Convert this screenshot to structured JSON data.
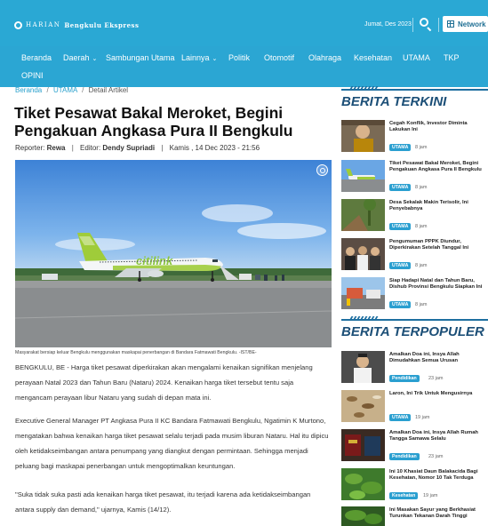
{
  "header": {
    "logo_harian": "HARIAN",
    "logo_name": "Bengkulu Ekspress",
    "date": "Jumat, Des 2023",
    "network_label": "Network"
  },
  "nav": {
    "items": [
      {
        "label": "Beranda"
      },
      {
        "label": "Daerah",
        "caret": "⌄"
      },
      {
        "label": "Sambungan Utama"
      },
      {
        "label": "Lainnya",
        "caret": "⌄"
      },
      {
        "label": "Politik"
      },
      {
        "label": "Otomotif"
      },
      {
        "label": "Olahraga"
      },
      {
        "label": "Kesehatan"
      },
      {
        "label": "UTAMA"
      },
      {
        "label": "TKP"
      },
      {
        "label": "OPINI"
      }
    ]
  },
  "breadcrumb": {
    "home": "Beranda",
    "section": "UTAMA",
    "current": "Detail Artikel",
    "separator": "/"
  },
  "article": {
    "title": "Tiket Pesawat Bakal Meroket, Begini Pengakuan Angkasa Pura II Bengkulu",
    "reporter_label": "Reporter:",
    "reporter": "Rewa",
    "editor_label": "Editor:",
    "editor": "Dendy Supriadi",
    "datetime": "Kamis , 14 Dec 2023 - 21:56",
    "meta_separator": "|",
    "aircraft_livery": "citilink",
    "caption": "Masyarakat bersiap keluar Bengkulu menggunakan maskapai penerbangan di Bandara Fatmawati Bengkulu. -IST/BE-",
    "paragraphs": [
      "BENGKULU, BE - Harga tiket pesawat diperkirakan akan mengalami kenaikan signifikan menjelang perayaan Natal 2023 dan Tahun Baru (Nataru) 2024. Kenaikan harga tiket tersebut tentu saja mengancam perayaan libur Nataru yang sudah di depan mata ini.",
      "Executive General Manager PT Angkasa Pura II KC Bandara Fatmawati Bengkulu, Ngatimin K Murtono, mengatakan bahwa kenaikan harga tiket pesawat selalu terjadi pada musim liburan Nataru. Hal itu dipicu oleh ketidakseimbangan antara penumpang yang diangkut dengan permintaan. Sehingga menjadi peluang bagi maskapai penerbangan untuk mengoptimalkan keuntungan.",
      "\"Suka tidak suka pasti ada kenaikan harga tiket pesawat, itu terjadi karena ada ketidakseimbangan antara supply dan demand,\" ujarnya, Kamis (14/12)."
    ]
  },
  "sidebar": {
    "terkini_title": "BERITA TERKINI",
    "terkini": [
      {
        "title": "Cegah Konflik, Investor Diminta Lakukan Ini",
        "badge": "UTAMA",
        "time": "8 jam"
      },
      {
        "title": "Tiket Pesawat Bakal Meroket, Begini Pengakuan Angkasa Pura II Bengkulu",
        "badge": "UTAMA",
        "time": "8 jam"
      },
      {
        "title": "Desa Sekalak Makin Terisolir, Ini Penyebabnya",
        "badge": "UTAMA",
        "time": "8 jam"
      },
      {
        "title": "Pengumuman PPPK Diundur, Diperkirakan Setelah Tanggal Ini",
        "badge": "UTAMA",
        "time": "8 jam"
      },
      {
        "title": "Siap Hadapi Natal dan Tahun Baru, Dishub Provinsi Bengkulu Siapkan Ini",
        "badge": "UTAMA",
        "time": "8 jam"
      }
    ],
    "populer_title": "BERITA TERPOPULER",
    "populer": [
      {
        "title": "Amalkan Doa ini, Insya Allah Dimudahkan Semua Urusan",
        "badge": "Pendidikan",
        "time": "23 jam"
      },
      {
        "title": "Laron, Ini Trik Untuk Mengusirnya",
        "badge": "UTAMA",
        "time": "19 jam"
      },
      {
        "title": "Amalkan Doa ini, Insya Allah Rumah Tangga Samawa Selalu",
        "badge": "Pendidikan",
        "time": "23 jam"
      },
      {
        "title": "Ini 10 Khasiat Daun Balakacida Bagi Kesehatan, Nomor 10 Tak Terduga",
        "badge": "Kesehatan",
        "time": "19 jam"
      },
      {
        "title": "Ini Masakan Sayur yang Berkhasiat Turunkan Tekanan Darah Tinggi",
        "badge": "",
        "time": ""
      }
    ]
  },
  "colors": {
    "header_bg": "#2aa8d4",
    "accent": "#2a9fd0",
    "section_title": "#1c4f77"
  }
}
